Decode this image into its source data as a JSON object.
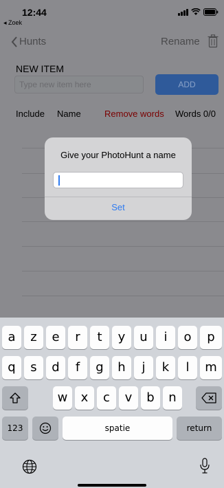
{
  "status": {
    "time": "12:44",
    "back_app": "◂ Zoek"
  },
  "nav": {
    "back_label": "Hunts",
    "rename_label": "Rename"
  },
  "new_item": {
    "title": "NEW ITEM",
    "placeholder": "Type new item here",
    "add_label": "ADD"
  },
  "columns": {
    "include": "Include",
    "name": "Name",
    "remove": "Remove words",
    "words": "Words 0/0"
  },
  "alert": {
    "title": "Give your PhotoHunt a name",
    "input_value": "",
    "set_label": "Set"
  },
  "keyboard": {
    "row1": [
      "a",
      "z",
      "e",
      "r",
      "t",
      "y",
      "u",
      "i",
      "o",
      "p"
    ],
    "row2": [
      "q",
      "s",
      "d",
      "f",
      "g",
      "h",
      "j",
      "k",
      "l",
      "m"
    ],
    "row3": [
      "w",
      "x",
      "c",
      "v",
      "b",
      "n"
    ],
    "numbers_label": "123",
    "space_label": "spatie",
    "return_label": "return"
  }
}
